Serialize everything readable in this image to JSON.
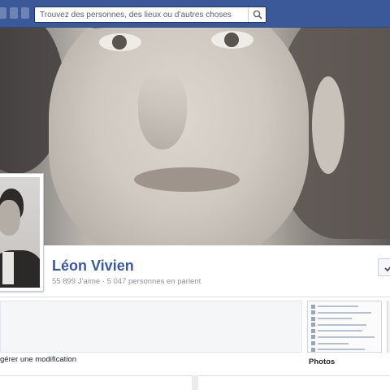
{
  "topbar": {
    "search_placeholder": "Trouvez des personnes, des lieux ou d’autres choses",
    "search_icon": "search-icon",
    "brand_color": "#3b5998"
  },
  "page": {
    "name": "Léon Vivien",
    "likes_line": "55 899 J’aime · 5 047 personnes en parlent",
    "action_icon": "checkmark-icon"
  },
  "about": {
    "suggest_edit": "gérer une modification"
  },
  "photos": {
    "label": "Photos"
  }
}
